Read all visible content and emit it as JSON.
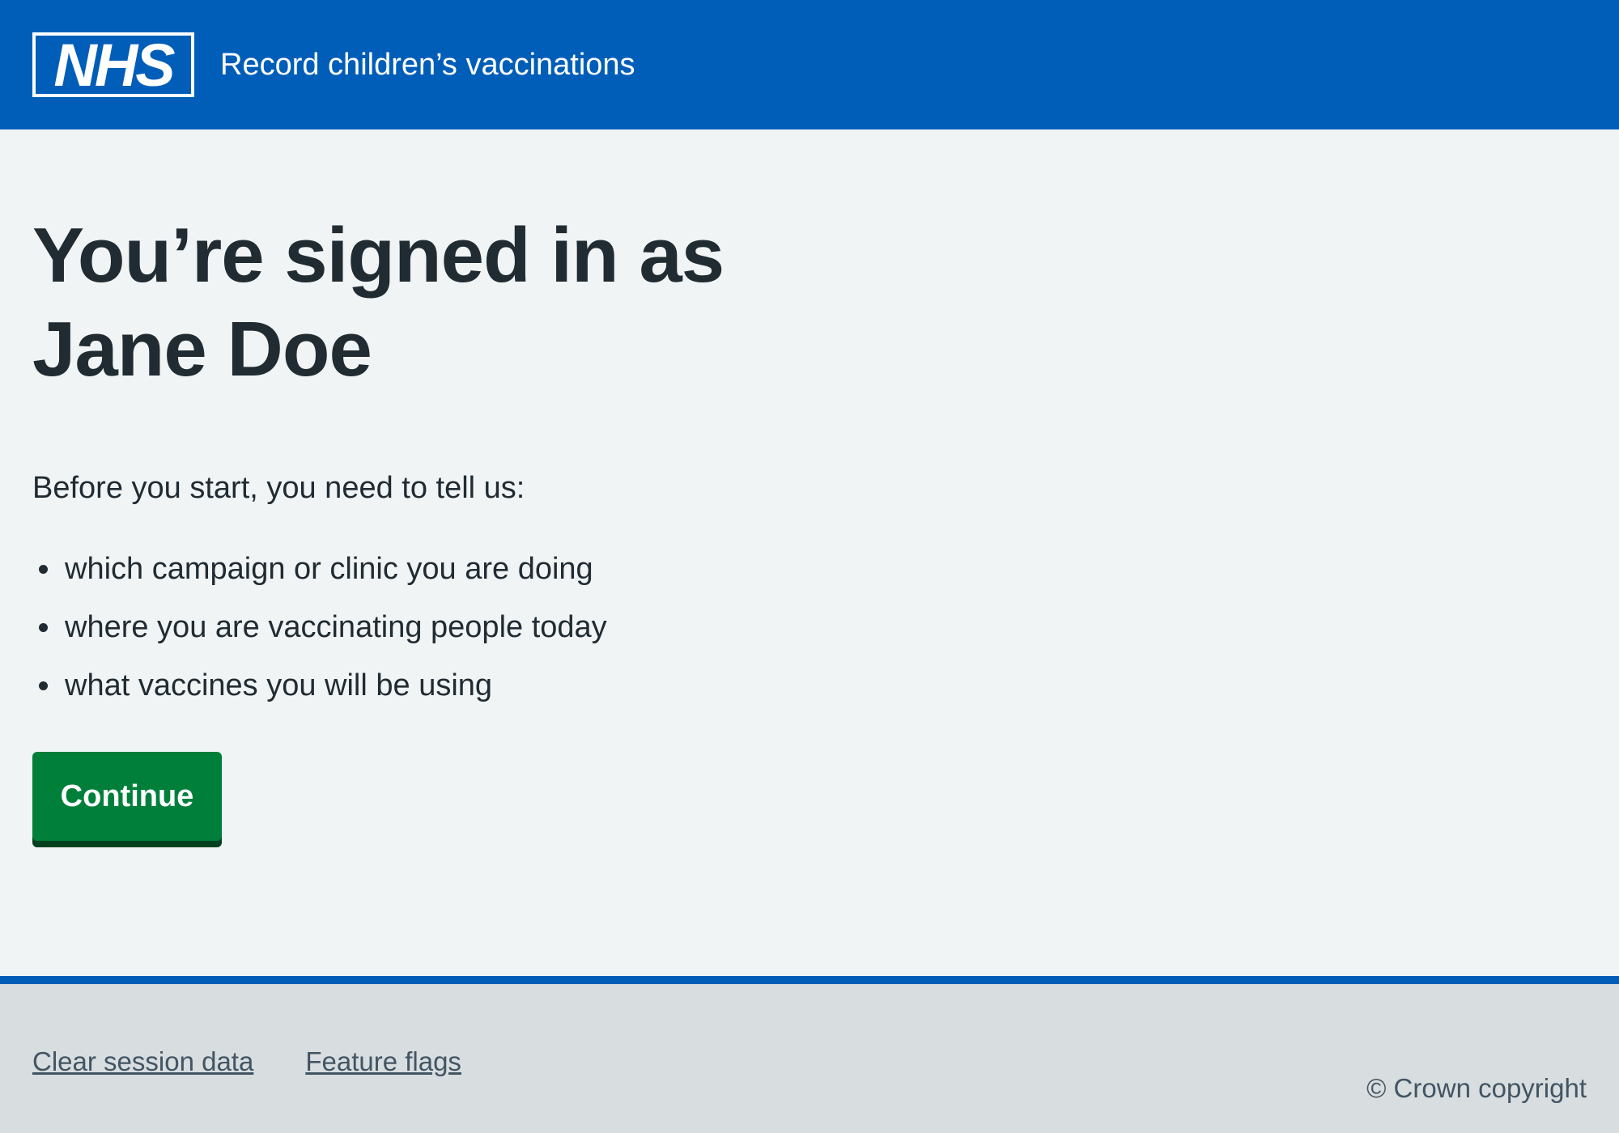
{
  "header": {
    "logo_text": "NHS",
    "service_name": "Record children’s vaccinations"
  },
  "main": {
    "title": "You’re signed in as Jane Doe",
    "intro": "Before you start, you need to tell us:",
    "items": [
      "which campaign or clinic you are doing",
      "where you are vaccinating people today",
      "what vaccines you will be using"
    ],
    "continue_label": "Continue"
  },
  "footer": {
    "links": [
      "Clear session data",
      "Feature flags"
    ],
    "copyright": "© Crown copyright"
  },
  "colors": {
    "header_blue": "#005eb8",
    "page_background": "#f0f4f5",
    "button_green": "#007f3b",
    "button_shadow": "#00401e",
    "text": "#212b32",
    "footer_background": "#d8dde0",
    "footer_text": "#425563"
  }
}
